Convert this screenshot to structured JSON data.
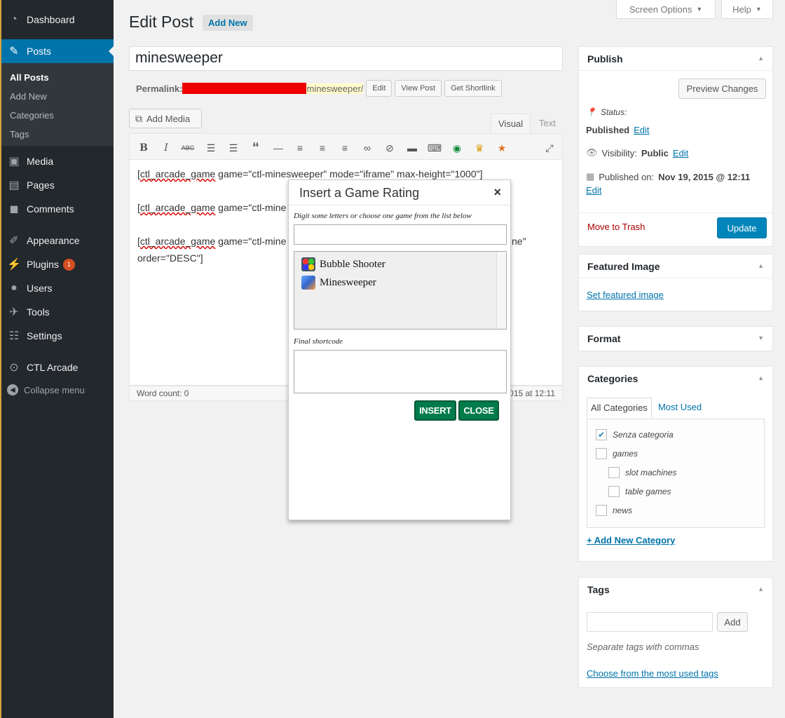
{
  "sidebar": {
    "items": [
      {
        "label": "Dashboard",
        "icon": "dashboard-icon"
      },
      {
        "label": "Posts",
        "icon": "pin-icon"
      },
      {
        "label": "Media",
        "icon": "media-icon"
      },
      {
        "label": "Pages",
        "icon": "pages-icon"
      },
      {
        "label": "Comments",
        "icon": "comments-icon"
      },
      {
        "label": "Appearance",
        "icon": "brush-icon"
      },
      {
        "label": "Plugins",
        "icon": "plugin-icon",
        "badge": "1"
      },
      {
        "label": "Users",
        "icon": "users-icon"
      },
      {
        "label": "Tools",
        "icon": "wrench-icon"
      },
      {
        "label": "Settings",
        "icon": "settings-icon"
      },
      {
        "label": "CTL Arcade",
        "icon": "gamepad-icon"
      }
    ],
    "posts_submenu": [
      "All Posts",
      "Add New",
      "Categories",
      "Tags"
    ],
    "collapse_label": "Collapse menu"
  },
  "header": {
    "screen_options": "Screen Options",
    "help": "Help",
    "title": "Edit Post",
    "add_new": "Add New"
  },
  "post": {
    "title": "minesweeper",
    "permalink_label": "Permalink:",
    "slug": "minesweeper/",
    "permalink_buttons": [
      "Edit",
      "View Post",
      "Get Shortlink"
    ]
  },
  "editor": {
    "add_media": "Add Media",
    "tab_visual": "Visual",
    "tab_text": "Text",
    "lines": [
      {
        "sc": "ctl_arcade_game",
        "rest": " game=\"ctl-minesweeper\" mode=\"iframe\" max-height=\"1000\"]"
      },
      {
        "sc": "ctl_arcade_game",
        "rest": " game=\"ctl-mine"
      },
      {
        "sc": "ctl_arcade_game",
        "rest": " game=\"ctl-mine"
      }
    ],
    "line3_right": "ne\"",
    "line4": "order=\"DESC\"]",
    "word_count": "Word count: 0",
    "last_edited": "015 at 12:11"
  },
  "publish": {
    "title": "Publish",
    "preview": "Preview Changes",
    "status_label": "Status:",
    "status_value": "Published",
    "visibility_label": "Visibility:",
    "visibility_value": "Public",
    "published_on_label": "Published on:",
    "published_on_value": "Nov 19, 2015 @ 12:11",
    "edit": "Edit",
    "trash": "Move to Trash",
    "update": "Update"
  },
  "featured_image": {
    "title": "Featured Image",
    "link": "Set featured image"
  },
  "format": {
    "title": "Format"
  },
  "categories": {
    "title": "Categories",
    "tab_all": "All Categories",
    "tab_most": "Most Used",
    "items": [
      {
        "label": "Senza categoria",
        "checked": true
      },
      {
        "label": "games",
        "checked": false
      },
      {
        "label": "slot machines",
        "checked": false
      },
      {
        "label": "table games",
        "checked": false
      },
      {
        "label": "news",
        "checked": false
      }
    ],
    "add_new": "+ Add New Category"
  },
  "tags": {
    "title": "Tags",
    "add": "Add",
    "hint": "Separate tags with commas",
    "choose": "Choose from the most used tags"
  },
  "modal": {
    "title": "Insert a Game Rating",
    "close_symbol": "×",
    "search_label": "Digit some letters or choose one game from the list below",
    "games": [
      "Bubble Shooter",
      "Minesweeper"
    ],
    "final_label": "Final shortcode",
    "insert": "INSERT",
    "close": "CLOSE"
  }
}
